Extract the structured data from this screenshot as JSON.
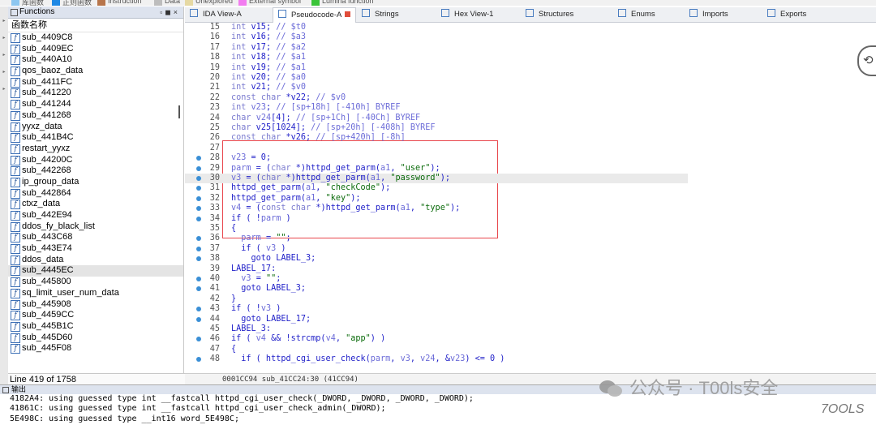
{
  "legend": [
    "库函数",
    "正则函数",
    "Instruction",
    "Data",
    "Unexplored",
    "External symbol",
    "Lumina function"
  ],
  "legend_colors": [
    "#8cc6f0",
    "#1e88e5",
    "#b7754b",
    "#bdbdbd",
    "#e6d9a3",
    "#f27cf0",
    "#3ac43a"
  ],
  "functions_panel": {
    "title": "Functions",
    "column_header": "函数名称",
    "items": [
      "sub_4409C8",
      "sub_4409EC",
      "sub_440A10",
      "qos_baoz_data",
      "sub_4411FC",
      "sub_441220",
      "sub_441244",
      "sub_441268",
      "yyxz_data",
      "sub_441B4C",
      "restart_yyxz",
      "sub_44200C",
      "sub_442268",
      "ip_group_data",
      "sub_442864",
      "ctxz_data",
      "sub_442E94",
      "ddos_fy_black_list",
      "sub_443C68",
      "sub_443E74",
      "ddos_data",
      "sub_4445EC",
      "sub_445800",
      "sq_limit_user_num_data",
      "sub_445908",
      "sub_4459CC",
      "sub_445B1C",
      "sub_445D60",
      "sub_445F08"
    ],
    "selected_index": 21,
    "status": "Line 419 of 1758"
  },
  "tabs": [
    {
      "label": "IDA View-A"
    },
    {
      "label": "Pseudocode-A"
    },
    {
      "label": "Strings"
    },
    {
      "label": "Hex View-1"
    },
    {
      "label": "Structures"
    },
    {
      "label": "Enums"
    },
    {
      "label": "Imports"
    },
    {
      "label": "Exports"
    }
  ],
  "active_tab": "Pseudocode-A",
  "code_lines": [
    {
      "n": "15",
      "bp": false,
      "t": "int v15; // $t0"
    },
    {
      "n": "16",
      "bp": false,
      "t": "int v16; // $a3"
    },
    {
      "n": "17",
      "bp": false,
      "t": "int v17; // $a2"
    },
    {
      "n": "18",
      "bp": false,
      "t": "int v18; // $a1"
    },
    {
      "n": "19",
      "bp": false,
      "t": "int v19; // $a1"
    },
    {
      "n": "20",
      "bp": false,
      "t": "int v20; // $a0"
    },
    {
      "n": "21",
      "bp": false,
      "t": "int v21; // $v0"
    },
    {
      "n": "22",
      "bp": false,
      "t": "const char *v22; // $v0"
    },
    {
      "n": "23",
      "bp": false,
      "t": "int v23; // [sp+18h] [-410h] BYREF"
    },
    {
      "n": "24",
      "bp": false,
      "t": "char v24[4]; // [sp+1Ch] [-40Ch] BYREF"
    },
    {
      "n": "25",
      "bp": false,
      "t": "char v25[1024]; // [sp+20h] [-408h] BYREF"
    },
    {
      "n": "26",
      "bp": false,
      "t": "const char *v26; // [sp+420h] [-8h]"
    },
    {
      "n": "27",
      "bp": false,
      "t": ""
    },
    {
      "n": "28",
      "bp": true,
      "t": "v23 = 0;"
    },
    {
      "n": "29",
      "bp": true,
      "t": "parm = (char *)httpd_get_parm(a1, \"user\");"
    },
    {
      "n": "30",
      "bp": true,
      "t": "v3 = (char *)httpd_get_parm(a1, \"password\");"
    },
    {
      "n": "31",
      "bp": true,
      "t": "httpd_get_parm(a1, \"checkCode\");"
    },
    {
      "n": "32",
      "bp": true,
      "t": "httpd_get_parm(a1, \"key\");"
    },
    {
      "n": "33",
      "bp": true,
      "t": "v4 = (const char *)httpd_get_parm(a1, \"type\");"
    },
    {
      "n": "34",
      "bp": true,
      "t": "if ( !parm )"
    },
    {
      "n": "35",
      "bp": false,
      "t": "{"
    },
    {
      "n": "36",
      "bp": true,
      "t": "  parm = \"\";"
    },
    {
      "n": "37",
      "bp": true,
      "t": "  if ( v3 )"
    },
    {
      "n": "38",
      "bp": true,
      "t": "    goto LABEL_3;"
    },
    {
      "n": "39",
      "bp": false,
      "t": "LABEL_17:"
    },
    {
      "n": "40",
      "bp": true,
      "t": "  v3 = \"\";"
    },
    {
      "n": "41",
      "bp": true,
      "t": "  goto LABEL_3;"
    },
    {
      "n": "42",
      "bp": false,
      "t": "}"
    },
    {
      "n": "43",
      "bp": true,
      "t": "if ( !v3 )"
    },
    {
      "n": "44",
      "bp": true,
      "t": "  goto LABEL_17;"
    },
    {
      "n": "45",
      "bp": false,
      "t": "LABEL_3:"
    },
    {
      "n": "46",
      "bp": true,
      "t": "if ( v4 && !strcmp(v4, \"app\") )"
    },
    {
      "n": "47",
      "bp": false,
      "t": "{"
    },
    {
      "n": "48",
      "bp": true,
      "t": "  if ( httpd_cgi_user_check(parm, v3, v24, &v23) <= 0 )"
    }
  ],
  "highlighted_line": "30",
  "code_status": "0001CC94 sub_41CC24:30 (41CC94)",
  "output": {
    "title": "输出",
    "lines": [
      "4182A4: using guessed type int __fastcall httpd_cgi_user_check(_DWORD, _DWORD, _DWORD, _DWORD);",
      "41861C: using guessed type int __fastcall httpd_cgi_user_check_admin(_DWORD);",
      "5E498C: using guessed type __int16 word_5E498C;"
    ]
  },
  "watermark": "公众号 · T00ls安全",
  "badge": "7OOLS"
}
